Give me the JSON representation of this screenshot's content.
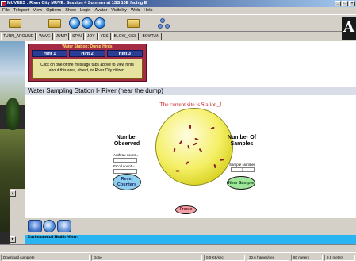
{
  "window": {
    "title": "MUVEES : River City MUVE: Session 4 Summer at 1SS 10E facing E",
    "controls": [
      "_",
      "□",
      "×"
    ]
  },
  "menu": [
    "File",
    "Teleport",
    "View",
    "Options",
    "Show",
    "Login",
    "Avatar",
    "Visibility",
    "Web",
    "Help"
  ],
  "commands": [
    "TURN_AROUND",
    "WAVE",
    "JUMP",
    "SPIN",
    "JOY",
    "YES",
    "BLOW_KISS",
    "BOWTAN"
  ],
  "brand_letter": "A",
  "hints": {
    "title": "Water Station: Dump Hints",
    "tabs": [
      "Hint 1",
      "Hint 2",
      "Hint 3"
    ],
    "body": "Click on one of the message tabs above to view hints about this area, object, or River City citizen."
  },
  "page_title": "Water Sampling Station I- River (near the dump)",
  "current_site": "The current site is Station_I",
  "left_panel": {
    "heading_line1": "Number",
    "heading_line2": "Observed",
    "anthrax_label": "Anthrax count =",
    "anthrax_value": "",
    "ecoli_label": "ECoil count =",
    "ecoli_value": ""
  },
  "right_panel": {
    "heading_line1": "Number Of",
    "heading_line2": "Samples",
    "sample_label": "Sample Number",
    "sample_value": "1"
  },
  "buttons": {
    "reset_line1": "Reset",
    "reset_line2": "Counters",
    "new_sample": "New Sample",
    "freeze": "Freeze",
    "prev": "<<",
    "next": ">>"
  },
  "env_meter": {
    "label": "Environmental Health Meter:",
    "value": ""
  },
  "status": {
    "left": "Download complete",
    "mid": "Done",
    "kbs": "0.0 KB/sec",
    "fps": "30.6 frames/sec",
    "dist1": "80 meters",
    "dist2": "9.5 meters"
  },
  "colors": {
    "hint_box": "#a52a43",
    "hint_tab": "#2b3e95",
    "site_text": "#c41414",
    "petri_dish": "#f4ef64",
    "env_bar": "#29b5f1"
  }
}
